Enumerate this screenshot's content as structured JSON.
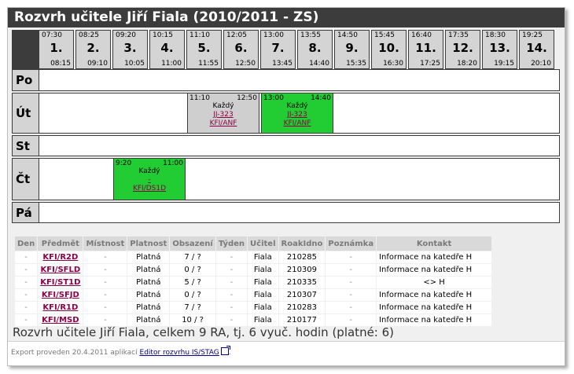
{
  "title": "Rozvrh učitele Jiří Fiala (2010/2011 - ZS)",
  "slots": [
    {
      "num": "1.",
      "start": "07:30",
      "end": "08:15"
    },
    {
      "num": "2.",
      "start": "08:25",
      "end": "09:10"
    },
    {
      "num": "3.",
      "start": "09:20",
      "end": "10:05"
    },
    {
      "num": "4.",
      "start": "10:15",
      "end": "11:00"
    },
    {
      "num": "5.",
      "start": "11:10",
      "end": "11:55"
    },
    {
      "num": "6.",
      "start": "12:05",
      "end": "12:50"
    },
    {
      "num": "7.",
      "start": "13:00",
      "end": "13:45"
    },
    {
      "num": "8.",
      "start": "13:55",
      "end": "14:40"
    },
    {
      "num": "9.",
      "start": "14:50",
      "end": "15:35"
    },
    {
      "num": "10.",
      "start": "15:45",
      "end": "16:30"
    },
    {
      "num": "11.",
      "start": "16:40",
      "end": "17:25"
    },
    {
      "num": "12.",
      "start": "17:35",
      "end": "18:20"
    },
    {
      "num": "13.",
      "start": "18:30",
      "end": "19:15"
    },
    {
      "num": "14.",
      "start": "19:25",
      "end": "20:10"
    }
  ],
  "days": [
    "Po",
    "Út",
    "St",
    "Čt",
    "Pá"
  ],
  "lessons": [
    {
      "day": "Út",
      "start": "11:10",
      "end": "12:50",
      "week": "Každý",
      "room": "JJ-323",
      "subject": "KFI/ANF",
      "color": "#cfcfcf"
    },
    {
      "day": "Út",
      "start": "13:00",
      "end": "14:40",
      "week": "Každý",
      "room": "JJ-323",
      "subject": "KFI/ANF",
      "color": "#22cc33"
    },
    {
      "day": "Čt",
      "start": "9:20",
      "end": "11:00",
      "week": "Každý",
      "room": "-",
      "subject": "KFI/DS1D",
      "color": "#22cc33"
    }
  ],
  "table": {
    "headers": [
      "Den",
      "Předmět",
      "Místnost",
      "Platnost",
      "Obsazení",
      "Týden",
      "Učitel",
      "RoakIdno",
      "Poznámka",
      "Kontakt"
    ],
    "rows": [
      [
        "-",
        "KFI/R2D",
        "-",
        "Platná",
        "7 / ?",
        "-",
        "Fiala",
        "210285",
        "-",
        "Informace na katedře H"
      ],
      [
        "-",
        "KFI/SFLD",
        "-",
        "Platná",
        "0 / ?",
        "-",
        "Fiala",
        "210309",
        "-",
        "Informace na katedře H"
      ],
      [
        "-",
        "KFI/ST1D",
        "-",
        "Platná",
        "5 / ?",
        "-",
        "Fiala",
        "210335",
        "-",
        "<> H"
      ],
      [
        "-",
        "KFI/SFJD",
        "-",
        "Platná",
        "0 / ?",
        "-",
        "Fiala",
        "210307",
        "-",
        "Informace na katedře H"
      ],
      [
        "-",
        "KFI/R1D",
        "-",
        "Platná",
        "7 / ?",
        "-",
        "Fiala",
        "210283",
        "-",
        "Informace na katedře H"
      ],
      [
        "-",
        "KFI/MSD",
        "-",
        "Platná",
        "10 / ?",
        "-",
        "Fiala",
        "210177",
        "-",
        "Informace na katedře H"
      ]
    ]
  },
  "summary": "Rozvrh učitele Jiří Fiala, celkem 9 RA, tj. 6 vyuč. hodin (platné: 6)",
  "footer": {
    "prefix": "Export proveden 20.4.2011 aplikací",
    "link": "Editor rozvrhu IS/STAG",
    "suffix": "."
  }
}
